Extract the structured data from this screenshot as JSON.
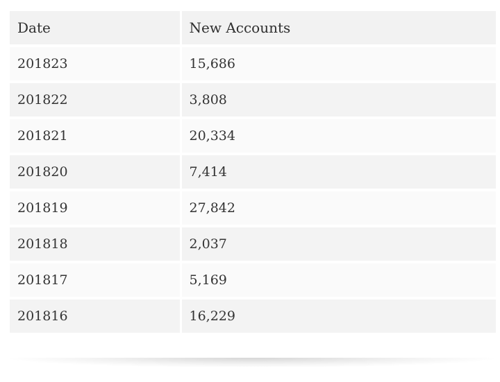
{
  "table": {
    "headers": [
      "Date",
      "New Accounts"
    ],
    "rows": [
      [
        "201823",
        "15,686"
      ],
      [
        "201822",
        "3,808"
      ],
      [
        "201821",
        "20,334"
      ],
      [
        "201820",
        "7,414"
      ],
      [
        "201819",
        "27,842"
      ],
      [
        "201818",
        "2,037"
      ],
      [
        "201817",
        "5,169"
      ],
      [
        "201816",
        "16,229"
      ]
    ]
  }
}
